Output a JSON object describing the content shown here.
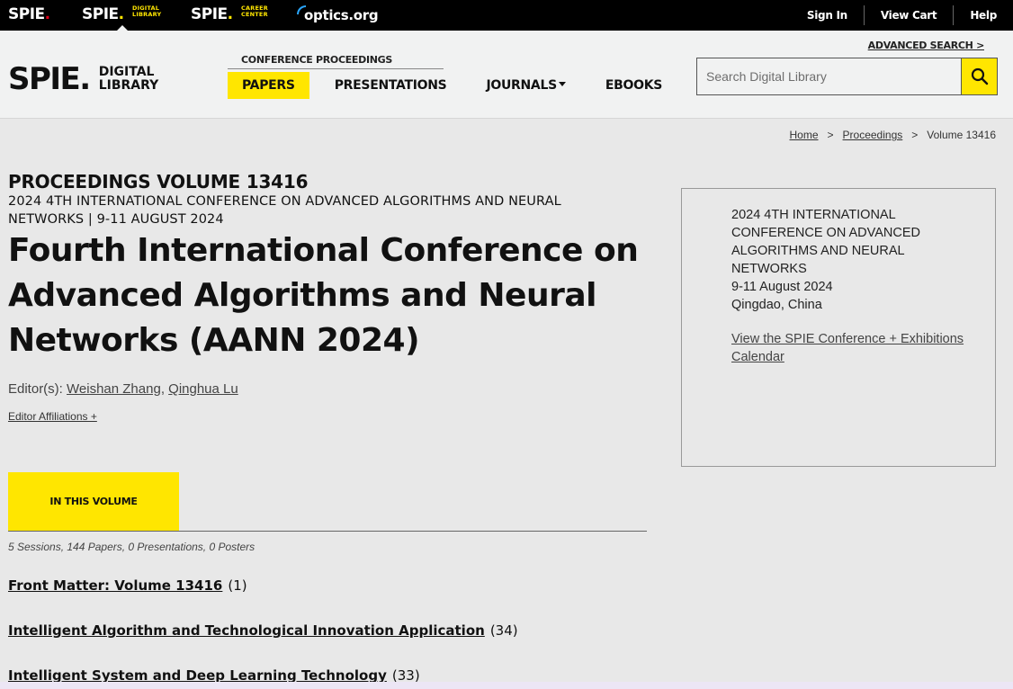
{
  "topbar": {
    "brands": [
      {
        "name": "SPIE",
        "sub": ""
      },
      {
        "name": "SPIE",
        "sub1": "DIGITAL",
        "sub2": "LIBRARY"
      },
      {
        "name": "SPIE",
        "sub1": "CAREER",
        "sub2": "CENTER"
      }
    ],
    "optics": "optics.org",
    "links": [
      "Sign In",
      "View Cart",
      "Help"
    ]
  },
  "header": {
    "logo_text1": "DIGITAL",
    "logo_text2": "LIBRARY",
    "logo_main": "SPIE",
    "conf_label": "CONFERENCE PROCEEDINGS",
    "tabs": [
      "PAPERS",
      "PRESENTATIONS",
      "JOURNALS",
      "EBOOKS"
    ],
    "advanced_search": "ADVANCED SEARCH >",
    "search_placeholder": "Search Digital Library"
  },
  "breadcrumb": {
    "home": "Home",
    "proceedings": "Proceedings",
    "current": "Volume 13416",
    "sep": ">"
  },
  "main": {
    "proc_volume": "PROCEEDINGS VOLUME 13416",
    "conf_sub": "2024 4TH INTERNATIONAL CONFERENCE ON ADVANCED ALGORITHMS AND NEURAL NETWORKS | 9-11 AUGUST 2024",
    "title": "Fourth International Conference on Advanced Algorithms and Neural Networks (AANN 2024)",
    "editors_label": "Editor(s):",
    "editor1": "Weishan Zhang",
    "editor_sep": ",",
    "editor2": "Qinghua Lu",
    "affiliations": "Editor Affiliations +",
    "in_this_volume": "IN THIS VOLUME",
    "counts": "5 Sessions, 144 Papers, 0 Presentations, 0 Posters",
    "sessions": [
      {
        "title": "Front Matter: Volume 13416",
        "count": "(1)"
      },
      {
        "title": "Intelligent Algorithm and Technological Innovation Application",
        "count": "(34)"
      },
      {
        "title": "Intelligent System and Deep Learning Technology",
        "count": "(33)"
      }
    ]
  },
  "sidebar": {
    "line1": "2024 4TH INTERNATIONAL",
    "line2": "CONFERENCE ON ADVANCED",
    "line3": "ALGORITHMS AND NEURAL",
    "line4": "NETWORKS",
    "dates": "9-11 August 2024",
    "location": "Qingdao, China",
    "calendar_link": "View the SPIE Conference + Exhibitions Calendar"
  },
  "colors": {
    "accent_yellow": "#ffe600",
    "spie_red": "#e2001a",
    "topbar_black": "#000000"
  }
}
